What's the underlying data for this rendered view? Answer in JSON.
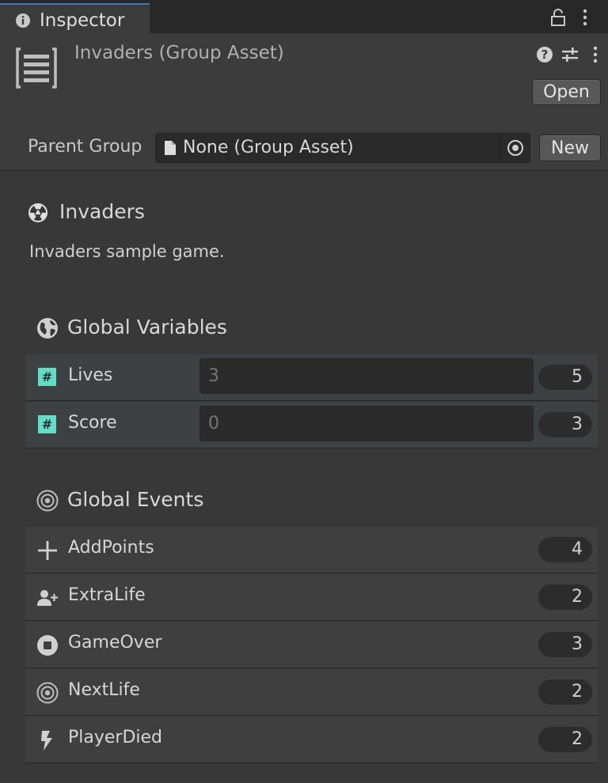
{
  "tab": {
    "title": "Inspector"
  },
  "header": {
    "asset_title": "Invaders (Group Asset)",
    "open_label": "Open",
    "parent_group_label": "Parent Group",
    "parent_group_value": "None (Group Asset)",
    "new_label": "New"
  },
  "group": {
    "name": "Invaders",
    "description": "Invaders sample game."
  },
  "variables": {
    "title": "Global Variables",
    "items": [
      {
        "name": "Lives",
        "placeholder": "3",
        "count": "5"
      },
      {
        "name": "Score",
        "placeholder": "0",
        "count": "3"
      }
    ]
  },
  "events": {
    "title": "Global Events",
    "items": [
      {
        "name": "AddPoints",
        "icon": "plus-icon",
        "count": "4"
      },
      {
        "name": "ExtraLife",
        "icon": "user-plus-icon",
        "count": "2"
      },
      {
        "name": "GameOver",
        "icon": "stop-icon",
        "count": "3"
      },
      {
        "name": "NextLife",
        "icon": "target-icon",
        "count": "2"
      },
      {
        "name": "PlayerDied",
        "icon": "bolt-icon",
        "count": "2"
      }
    ]
  },
  "colors": {
    "accent_tab": "#3a79bb",
    "variable_badge": "#61ddc8",
    "background": "#383838"
  }
}
